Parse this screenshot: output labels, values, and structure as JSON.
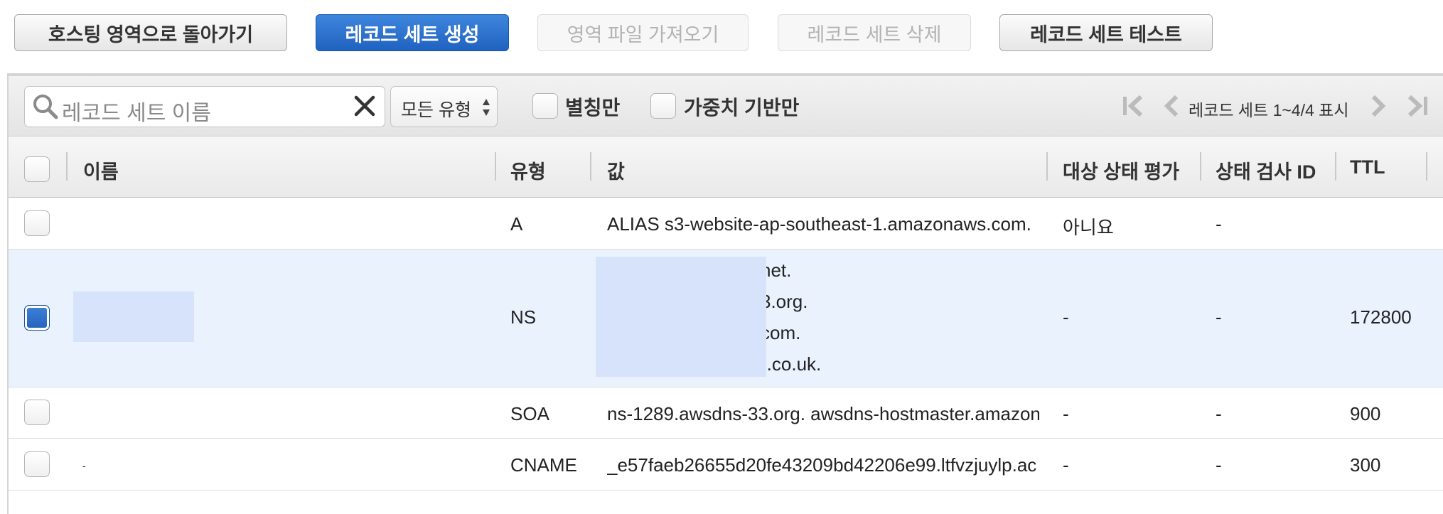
{
  "actions": {
    "back": "호스팅 영역으로 돌아가기",
    "create": "레코드 세트 생성",
    "import": "영역 파일 가져오기",
    "delete": "레코드 세트 삭제",
    "test": "레코드 세트 테스트"
  },
  "toolbar": {
    "search_placeholder": "레코드 세트 이름",
    "type_filter": "모든 유형",
    "alias_only": "별칭만",
    "weighted_only": "가중치 기반만",
    "pagination": "레코드 세트 1~4/4 표시"
  },
  "columns": [
    "이름",
    "유형",
    "값",
    "대상 상태 평가",
    "상태 검사 ID",
    "TTL"
  ],
  "rows": [
    {
      "name": "",
      "type": "A",
      "value": "ALIAS s3-website-ap-southeast-1.amazonaws.com.",
      "health_eval": "아니요",
      "health_id": "-",
      "ttl": "",
      "selected": false
    },
    {
      "name": "",
      "type": "NS",
      "value_lines": [
        "net.",
        "3.org.",
        "com.",
        ").co.uk."
      ],
      "health_eval": "-",
      "health_id": "-",
      "ttl": "172800",
      "selected": true
    },
    {
      "name": "",
      "type": "SOA",
      "value": "ns-1289.awsdns-33.org. awsdns-hostmaster.amazon",
      "health_eval": "-",
      "health_id": "-",
      "ttl": "900",
      "selected": false
    },
    {
      "name": "-",
      "type": "CNAME",
      "value": "_e57faeb26655d20fe43209bd42206e99.ltfvzjuylp.ac",
      "health_eval": "-",
      "health_id": "-",
      "ttl": "300",
      "selected": false
    }
  ],
  "colors": {
    "primary": "#2a6fcd",
    "selected_row": "#eaf2fe",
    "redaction": "#d6e3fb"
  }
}
